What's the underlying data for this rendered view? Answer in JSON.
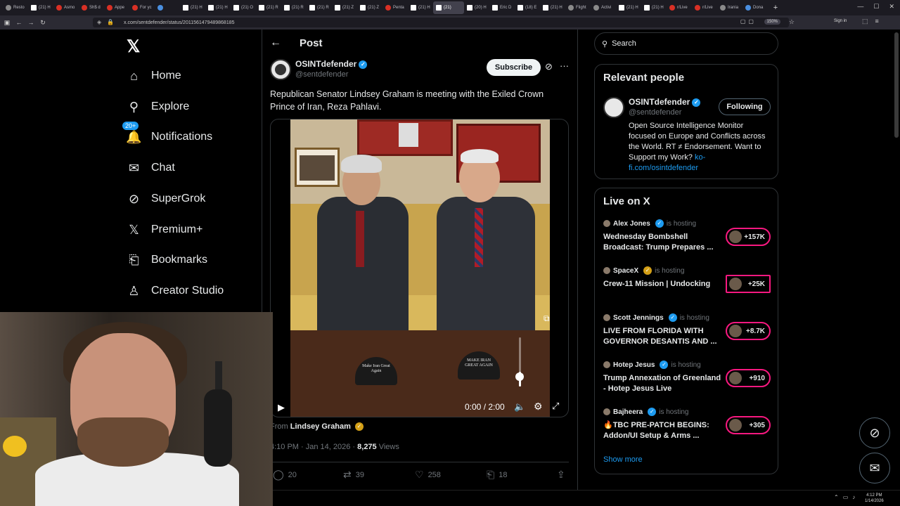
{
  "browser": {
    "tabs": [
      {
        "label": "Resto",
        "fav": "gray"
      },
      {
        "label": "(21) H",
        "fav": "x"
      },
      {
        "label": "Asmo",
        "fav": "red"
      },
      {
        "label": "Sh$ d",
        "fav": "red"
      },
      {
        "label": "Appe",
        "fav": "red"
      },
      {
        "label": "For yc",
        "fav": "red"
      },
      {
        "label": "",
        "fav": "blue"
      },
      {
        "label": "(21) H",
        "fav": "x"
      },
      {
        "label": "(21) H",
        "fav": "x"
      },
      {
        "label": "(21) O",
        "fav": "x"
      },
      {
        "label": "(21) R",
        "fav": "x"
      },
      {
        "label": "(21) R",
        "fav": "x"
      },
      {
        "label": "(21) R",
        "fav": "x"
      },
      {
        "label": "(21) Z",
        "fav": "x"
      },
      {
        "label": "(21) Z",
        "fav": "x"
      },
      {
        "label": "Penta",
        "fav": "red"
      },
      {
        "label": "(21) H",
        "fav": "x"
      },
      {
        "label": "(21)",
        "fav": "x",
        "active": true
      },
      {
        "label": "(20) H",
        "fav": "x"
      },
      {
        "label": "Eric D",
        "fav": "x"
      },
      {
        "label": "(18) E",
        "fav": "x"
      },
      {
        "label": "(21) H",
        "fav": "x"
      },
      {
        "label": "Flight",
        "fav": "gray"
      },
      {
        "label": "Activi",
        "fav": "gray"
      },
      {
        "label": "(21) H",
        "fav": "x"
      },
      {
        "label": "(21) H",
        "fav": "x"
      },
      {
        "label": "r/Live",
        "fav": "red"
      },
      {
        "label": "r/Live",
        "fav": "red"
      },
      {
        "label": "Irania",
        "fav": "gray"
      },
      {
        "label": "Dona",
        "fav": "blue"
      }
    ],
    "url": "x.com/sentdefender/status/2011561479489868185",
    "zoom": "150%",
    "signin": "Sign in"
  },
  "nav": {
    "items": [
      {
        "label": "Home",
        "icon": "home-icon",
        "glyph": "⌂"
      },
      {
        "label": "Explore",
        "icon": "search-icon",
        "glyph": "⚲"
      },
      {
        "label": "Notifications",
        "icon": "bell-icon",
        "glyph": "🔔",
        "badge": "20+"
      },
      {
        "label": "Chat",
        "icon": "mail-icon",
        "glyph": "✉"
      },
      {
        "label": "SuperGrok",
        "icon": "grok-icon",
        "glyph": "⊘"
      },
      {
        "label": "Premium+",
        "icon": "x-icon",
        "glyph": "𝕏"
      },
      {
        "label": "Bookmarks",
        "icon": "bookmark-icon",
        "glyph": "⎗"
      },
      {
        "label": "Creator Studio",
        "icon": "creator-icon",
        "glyph": "♙"
      }
    ]
  },
  "post": {
    "header": "Post",
    "author_name": "OSINTdefender",
    "author_handle": "@sentdefender",
    "subscribe": "Subscribe",
    "text": "Republican Senator Lindsey Graham is meeting with the Exiled Crown Prince of Iran, Reza Pahlavi.",
    "hat1": "Make Iran Great Again",
    "hat2": "MAKE IRAN GREAT AGAIN",
    "video_time": "0:00 / 2:00",
    "volume_level": 0.3,
    "from_prefix": "From",
    "from_name": "Lindsey Graham",
    "timestamp": "4:10 PM · Jan 14, 2026 · ",
    "views_count": "8,275",
    "views_label": " Views",
    "replies": "20",
    "reposts": "39",
    "likes": "258",
    "bookmarks": "18"
  },
  "sidebar": {
    "search_placeholder": "Search",
    "relevant_title": "Relevant people",
    "rp_name": "OSINTdefender",
    "rp_handle": "@sentdefender",
    "following": "Following",
    "rp_bio": "Open Source Intelligence Monitor focused on Europe and Conflicts across the World. RT ≠ Endorsement. Want to Support my Work? ",
    "rp_link": "ko-fi.com/osintdefender",
    "live_title": "Live on X",
    "hosting_label": "is hosting",
    "live": [
      {
        "host": "Alex Jones",
        "badge": "blue",
        "title": "Wednesday Bombshell Broadcast: Trump Prepares ...",
        "count": "+157K"
      },
      {
        "host": "SpaceX",
        "badge": "gold",
        "title": "Crew-11 Mission | Undocking",
        "count": "+25K"
      },
      {
        "host": "Scott Jennings",
        "badge": "blue",
        "title": "LIVE FROM FLORIDA WITH GOVERNOR DESANTIS AND ...",
        "count": "+8.7K"
      },
      {
        "host": "Hotep Jesus",
        "badge": "blue",
        "title": "Trump Annexation of Greenland - Hotep Jesus Live",
        "count": "+910"
      },
      {
        "host": "Bajheera",
        "badge": "blue",
        "title": "🔥TBC PRE-PATCH BEGINS: Addon/UI Setup & Arms ...",
        "count": "+305"
      }
    ],
    "show_more": "Show more"
  },
  "taskbar": {
    "time": "4:12 PM",
    "date": "1/14/2026"
  }
}
